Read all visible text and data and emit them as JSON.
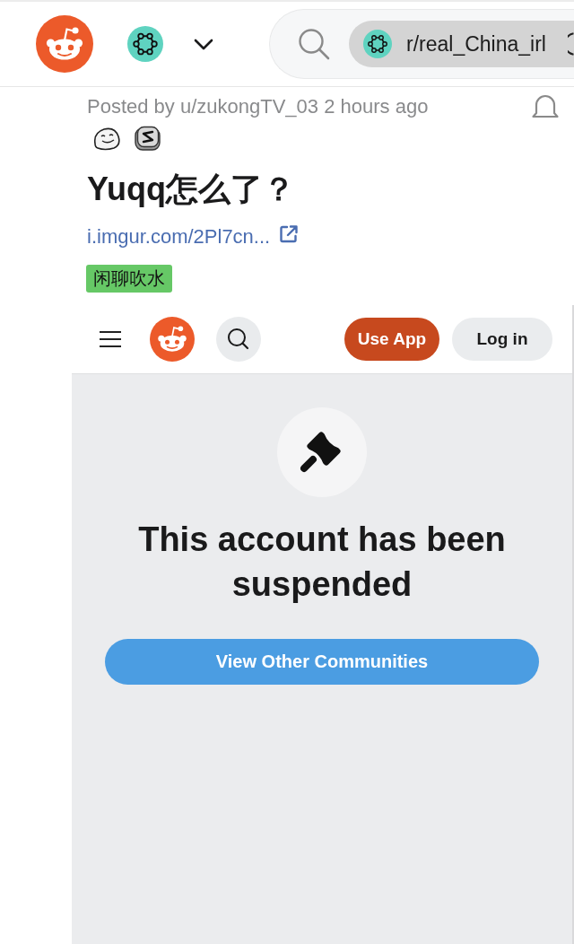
{
  "top_bar": {
    "community_chip": {
      "label": "r/real_China_irl"
    }
  },
  "post": {
    "byline": "Posted by u/zukongTV_03 2 hours ago",
    "title": "Yuqq怎么了？",
    "link": "i.imgur.com/2Pl7cn...",
    "flair": "闲聊吹水"
  },
  "embedded_screenshot": {
    "header_buttons": [
      {
        "label": "Use App",
        "kind": "primary"
      },
      {
        "label": "Log in",
        "kind": "secondary"
      }
    ],
    "message": "This account has been suspended",
    "action_button": "View Other Communities"
  }
}
